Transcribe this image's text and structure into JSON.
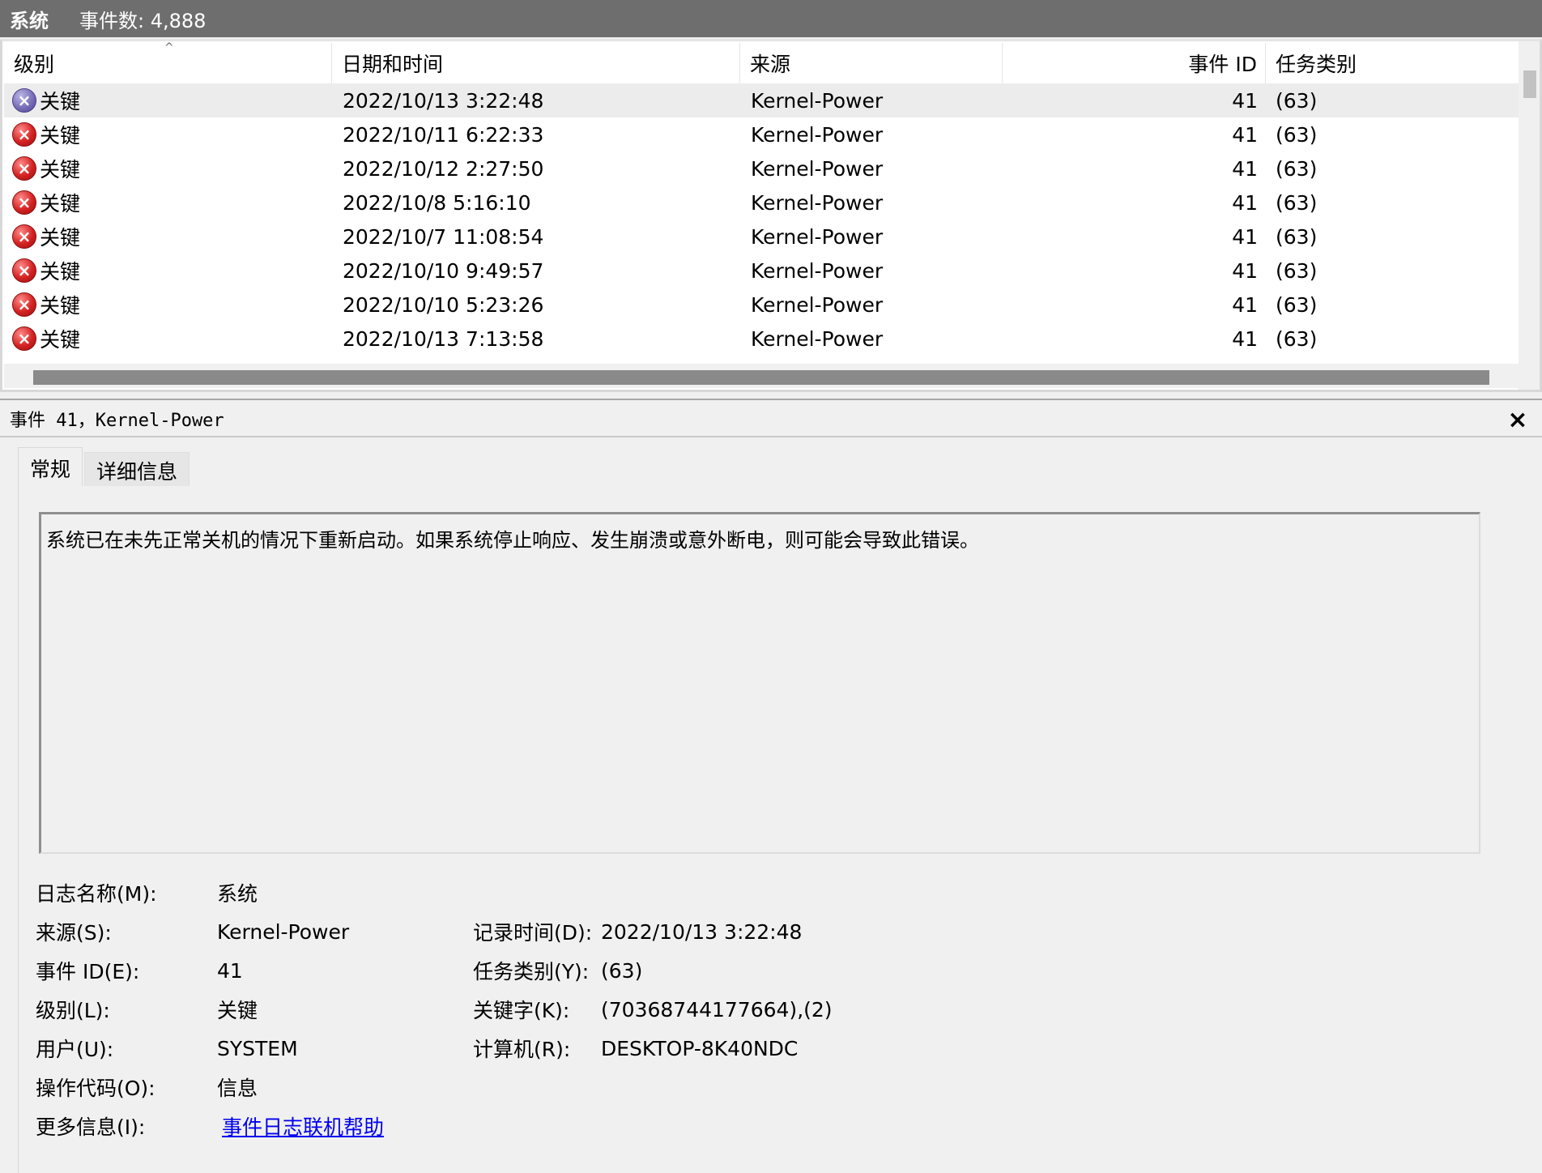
{
  "topbar": {
    "log_name": "系统",
    "event_count": "事件数: 4,888"
  },
  "list": {
    "columns": [
      "级别",
      "日期和时间",
      "来源",
      "事件 ID",
      "任务类别"
    ],
    "sort_indicator": "^",
    "rows": [
      {
        "level": "关键",
        "datetime": "2022/10/13 3:22:48",
        "source": "Kernel-Power",
        "event_id": "41",
        "task": "(63)"
      },
      {
        "level": "关键",
        "datetime": "2022/10/11 6:22:33",
        "source": "Kernel-Power",
        "event_id": "41",
        "task": "(63)"
      },
      {
        "level": "关键",
        "datetime": "2022/10/12 2:27:50",
        "source": "Kernel-Power",
        "event_id": "41",
        "task": "(63)"
      },
      {
        "level": "关键",
        "datetime": "2022/10/8 5:16:10",
        "source": "Kernel-Power",
        "event_id": "41",
        "task": "(63)"
      },
      {
        "level": "关键",
        "datetime": "2022/10/7 11:08:54",
        "source": "Kernel-Power",
        "event_id": "41",
        "task": "(63)"
      },
      {
        "level": "关键",
        "datetime": "2022/10/10 9:49:57",
        "source": "Kernel-Power",
        "event_id": "41",
        "task": "(63)"
      },
      {
        "level": "关键",
        "datetime": "2022/10/10 5:23:26",
        "source": "Kernel-Power",
        "event_id": "41",
        "task": "(63)"
      },
      {
        "level": "关键",
        "datetime": "2022/10/13 7:13:58",
        "source": "Kernel-Power",
        "event_id": "41",
        "task": "(63)"
      }
    ],
    "icon": "critical-error-icon"
  },
  "detail": {
    "title": "事件 41，Kernel-Power",
    "close_label": "×",
    "tabs": [
      "常规",
      "详细信息"
    ],
    "description": "系统已在未先正常关机的情况下重新启动。如果系统停止响应、发生崩溃或意外断电，则可能会导致此错误。",
    "labels": {
      "log_name": "日志名称(M):",
      "source": "来源(S):",
      "event_id": "事件 ID(E):",
      "level": "级别(L):",
      "user": "用户(U):",
      "opcode": "操作代码(O):",
      "more_info": "更多信息(I):",
      "logged": "记录时间(D):",
      "task_category": "任务类别(Y):",
      "keywords": "关键字(K):",
      "computer": "计算机(R):"
    },
    "values": {
      "log_name": "系统",
      "source": "Kernel-Power",
      "event_id": "41",
      "level": "关键",
      "user": "SYSTEM",
      "opcode": "信息",
      "more_info_link": "事件日志联机帮助",
      "logged": "2022/10/13 3:22:48",
      "task_category": "(63)",
      "keywords": "(70368744177664),(2)",
      "computer": "DESKTOP-8K40NDC"
    }
  }
}
